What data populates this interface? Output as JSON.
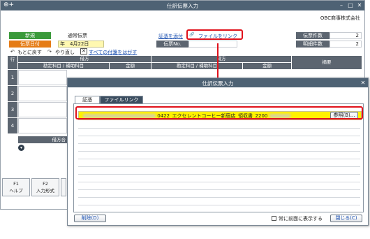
{
  "back_window": {
    "title": "仕訳伝票入力",
    "app_icon": "⊕+",
    "company": "OBC商事株式会社",
    "new_label": "新規",
    "voucher_type": "通常伝票",
    "date_label": "伝票日付",
    "date_value": "年　4月22日",
    "voucher_no_label": "伝票No.",
    "evidence_link": "証憑を添付",
    "file_link": "ファイルをリンク",
    "count_label": "伝票件数",
    "count_value": "2",
    "detail_count_label": "明細件数",
    "detail_count_value": "2",
    "undo": "もとに戻す",
    "redo": "やり直し",
    "remove_tags": "すべての付箋をはがす",
    "grid": {
      "row_header": "行",
      "debit": "借方",
      "credit": "貸方",
      "account_debit": "勘定科目 / 補助科目",
      "amount_debit": "金額",
      "account_credit": "勘定科目 / 補助科目",
      "amount_credit": "金額",
      "memo": "摘要",
      "rows": [
        "1",
        "2",
        "3",
        "4"
      ],
      "total_label": "借方合"
    },
    "fkeys": [
      {
        "key": "F1",
        "label": "ヘルプ"
      },
      {
        "key": "F2",
        "label": "入力形式"
      }
    ]
  },
  "dialog": {
    "title": "仕訳伝票入力",
    "tabs": [
      "証憑",
      "ファイルリンク"
    ],
    "file_name": "0422_エクセレントコーヒー新宿店_領収書_2200",
    "browse_button": "参照(B)...",
    "delete_button": "削除(D)",
    "always_on_top": "常に前面に表示する",
    "close_button": "閉じる(C)"
  },
  "colors": {
    "titlebar": "#4e6274",
    "highlight": "#fff200",
    "callout": "#e0111b"
  }
}
